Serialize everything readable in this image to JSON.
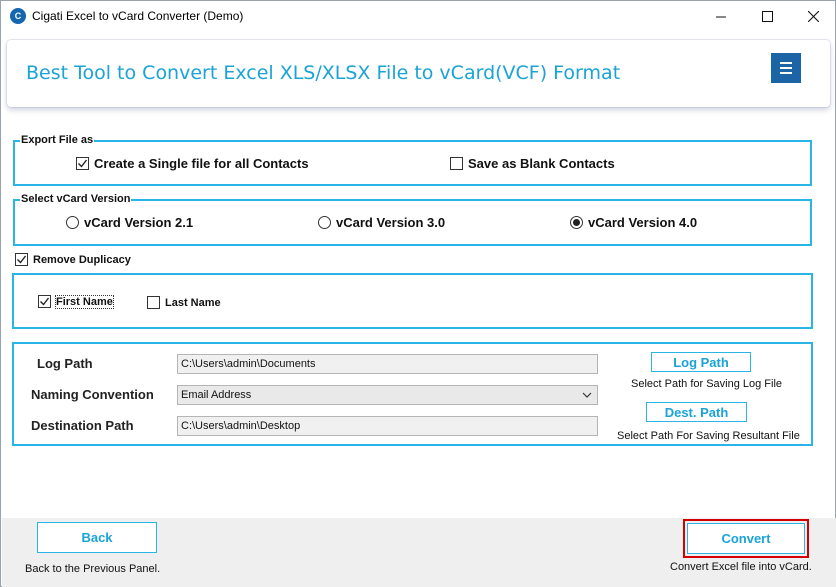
{
  "window": {
    "title": "Cigati Excel to vCard Converter (Demo)",
    "app_icon_text": "C"
  },
  "banner": {
    "title": "Best Tool to Convert Excel XLS/XLSX File to vCard(VCF) Format"
  },
  "export_group": {
    "legend": "Export File as",
    "single_file_label": "Create a Single file for all Contacts",
    "single_file_checked": true,
    "blank_contacts_label": "Save as Blank Contacts",
    "blank_contacts_checked": false
  },
  "version_group": {
    "legend": "Select vCard Version",
    "options": [
      {
        "label": "vCard Version 2.1",
        "selected": false
      },
      {
        "label": "vCard Version 3.0",
        "selected": false
      },
      {
        "label": "vCard Version 4.0",
        "selected": true
      }
    ]
  },
  "duplicacy": {
    "label": "Remove Duplicacy",
    "checked": true,
    "first_name_label": "First Name",
    "first_name_checked": true,
    "last_name_label": "Last Name",
    "last_name_checked": false
  },
  "paths": {
    "log_path_label": "Log Path",
    "log_path_value": "C:\\Users\\admin\\Documents",
    "naming_label": "Naming Convention",
    "naming_value": "Email Address",
    "dest_label": "Destination Path",
    "dest_value": "C:\\Users\\admin\\Desktop",
    "log_path_button": "Log Path",
    "log_path_hint": "Select Path for Saving Log File",
    "dest_button": "Dest. Path",
    "dest_hint": "Select Path For Saving Resultant File"
  },
  "footer": {
    "back_label": "Back",
    "back_hint": "Back to the Previous Panel.",
    "convert_label": "Convert",
    "convert_hint": "Convert Excel file into vCard."
  },
  "colors": {
    "accent": "#29b6e6",
    "title_blue": "#1aa3d6",
    "menu_blue": "#1b64a5",
    "highlight_red": "#d40000"
  }
}
